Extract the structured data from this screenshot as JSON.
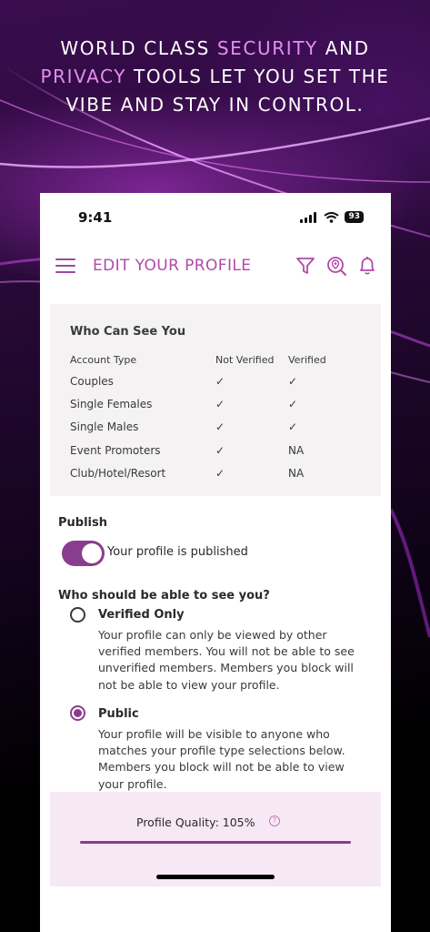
{
  "promo": {
    "line1_pre": "WORLD CLASS ",
    "line1_accent": "SECURITY",
    "line1_post": " AND",
    "line2_accent": "PRIVACY",
    "line2_post": " TOOLS LET YOU SET THE",
    "line3": "VIBE AND STAY IN CONTROL.",
    "accent_color": "#e38ff0"
  },
  "status_bar": {
    "time": "9:41",
    "battery": "93"
  },
  "app_bar": {
    "title": "EDIT YOUR PROFILE",
    "brand_color": "#b04aa8",
    "icons": [
      "filter-icon",
      "search-location-icon",
      "bell-icon"
    ]
  },
  "privacy_card": {
    "title": "Who Can See You",
    "columns": [
      "Account Type",
      "Not Verified",
      "Verified"
    ],
    "rows": [
      {
        "type": "Couples",
        "not_verified": "✓",
        "verified": "✓"
      },
      {
        "type": "Single Females",
        "not_verified": "✓",
        "verified": "✓"
      },
      {
        "type": "Single Males",
        "not_verified": "✓",
        "verified": "✓"
      },
      {
        "type": "Event Promoters",
        "not_verified": "✓",
        "verified": "NA"
      },
      {
        "type": "Club/Hotel/Resort",
        "not_verified": "✓",
        "verified": "NA"
      }
    ]
  },
  "publish": {
    "label": "Publish",
    "enabled": true,
    "status_text": "Your profile is published"
  },
  "visibility": {
    "question": "Who should be able to see you?",
    "options": [
      {
        "title": "Verified Only",
        "selected": false,
        "description": "Your profile can only be viewed by other verified members. You will not be able to see unverified members. Members you block will not be able to view your profile."
      },
      {
        "title": "Public",
        "selected": true,
        "description": "Your profile will be visible to anyone who matches your profile type selections below. Members you block will not be able to view your profile."
      }
    ]
  },
  "quality": {
    "label": "Profile Quality: 105%",
    "help": "?",
    "progress": 1.0,
    "accent_color": "#8a3d8e"
  }
}
